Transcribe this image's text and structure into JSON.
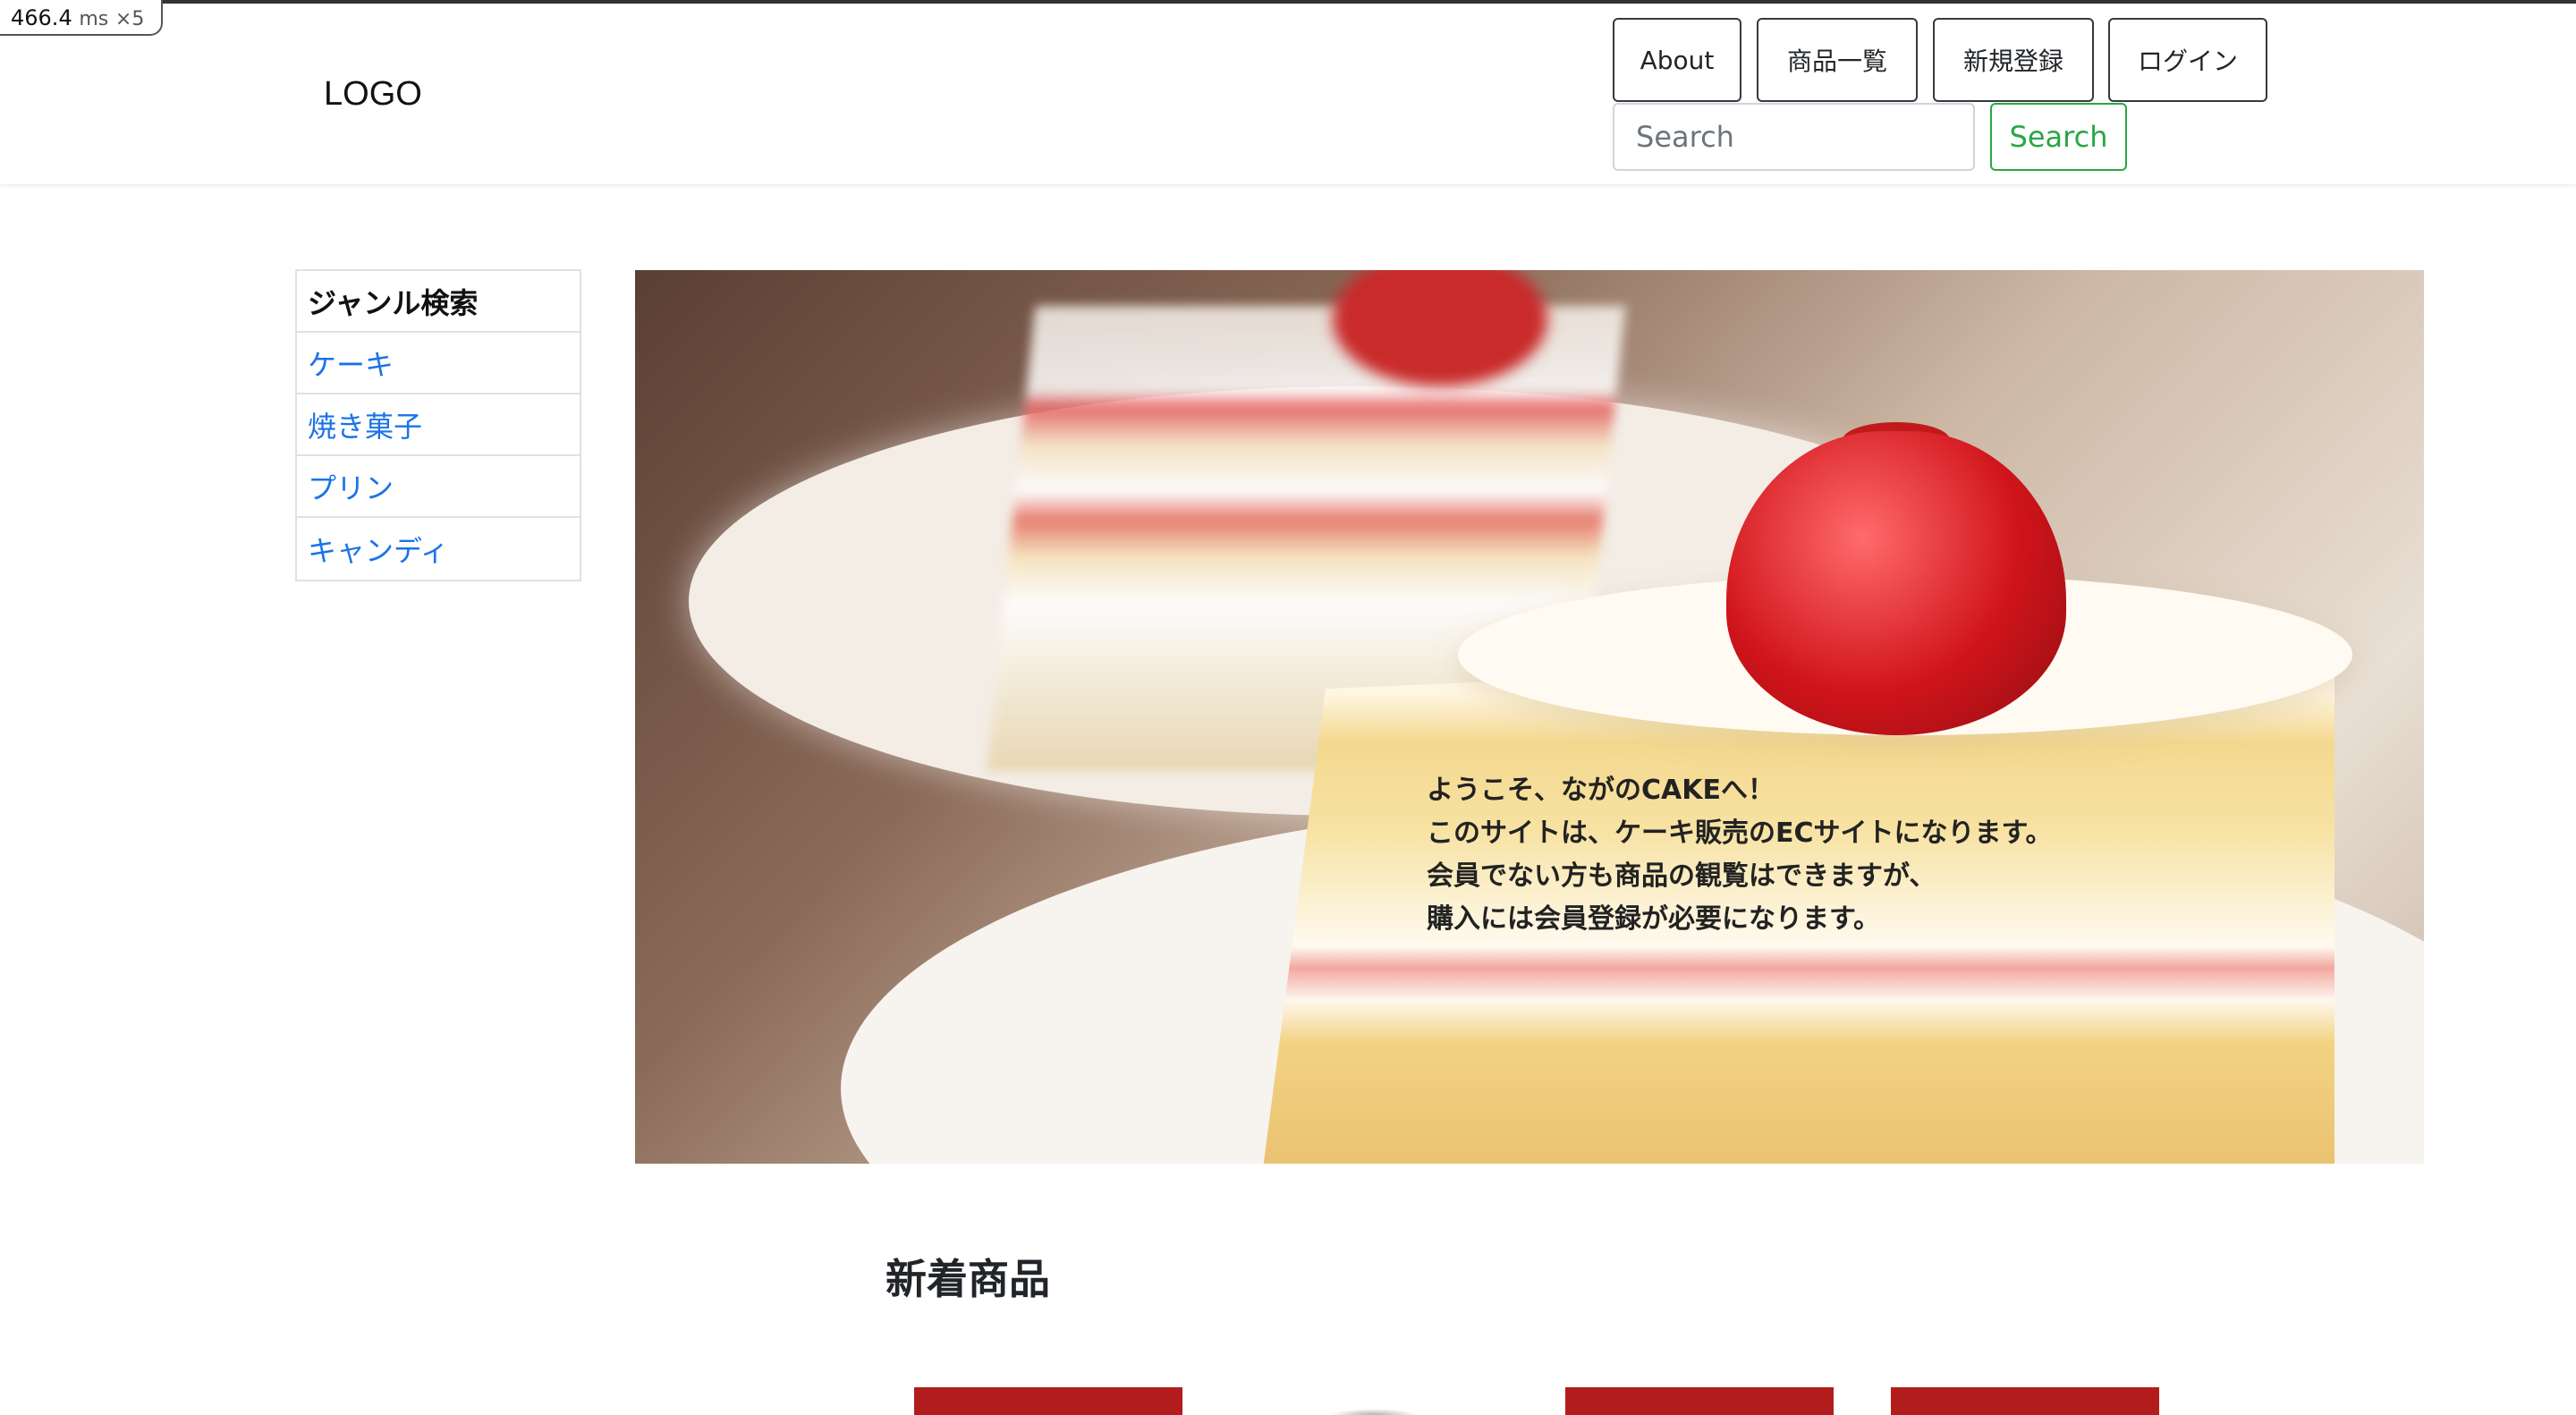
{
  "perf_badge": {
    "value": "466.4",
    "unit": "ms",
    "multiplier": "×5"
  },
  "header": {
    "logo": "LOGO",
    "nav": [
      {
        "label": "About"
      },
      {
        "label": "商品一覧"
      },
      {
        "label": "新規登録"
      },
      {
        "label": "ログイン"
      }
    ],
    "search": {
      "placeholder": "Search",
      "button_label": "Search"
    }
  },
  "sidebar": {
    "title": "ジャンル検索",
    "genres": [
      {
        "label": "ケーキ"
      },
      {
        "label": "焼き菓子"
      },
      {
        "label": "プリン"
      },
      {
        "label": "キャンディ"
      }
    ]
  },
  "hero": {
    "lines": [
      "ようこそ、ながのCAKEへ！",
      "このサイトは、ケーキ販売のECサイトになります。",
      "会員でない方も商品の観覧はできますが、",
      "購入には会員登録が必要になります。"
    ]
  },
  "new_products": {
    "title": "新着商品"
  },
  "colors": {
    "accent_green": "#28a745",
    "link_blue": "#1a73e8",
    "product_red": "#b31c1c"
  }
}
